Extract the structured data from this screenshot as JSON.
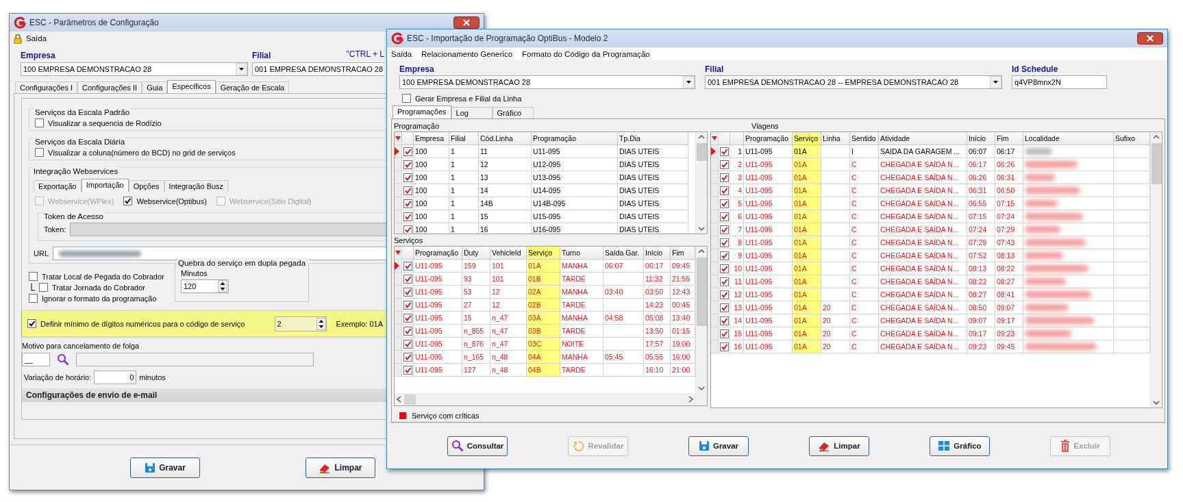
{
  "config_window": {
    "title": "ESC - Parâmetros de Configuração",
    "menu": [
      {
        "label": "Saída"
      }
    ],
    "empresa": {
      "label": "Empresa",
      "value": "100 EMPRESA DEMONSTRACAO 28"
    },
    "filial": {
      "label": "Filial",
      "value": "001 EMPRESA DEMONSTRACAO 28"
    },
    "shortcut_hint": "\"CTRL + L",
    "tabs": [
      {
        "label": "Configurações I",
        "selected": false
      },
      {
        "label": "Configurações II",
        "selected": false
      },
      {
        "label": "Guia",
        "selected": false
      },
      {
        "label": "Específicos",
        "selected": true
      },
      {
        "label": "Geração de Escala",
        "selected": false
      }
    ],
    "groups": [
      {
        "title": "Serviços da Escala Padrão",
        "option": {
          "label": "Visualizar a sequencia de Rodízio",
          "checked": false
        }
      },
      {
        "title": "Serviços da Escala Diária",
        "option": {
          "label": "Visualizar a coluna(número do BCD) no grid de serviços",
          "checked": false
        }
      }
    ],
    "webservices": {
      "title": "Integração Webservices",
      "tabs": [
        {
          "label": "Exportação",
          "selected": false
        },
        {
          "label": "Importação",
          "selected": true
        },
        {
          "label": "Opções",
          "selected": false
        },
        {
          "label": "Integração Busz",
          "selected": false
        }
      ],
      "options": [
        {
          "label": "Webservice(WPlex)",
          "checked": false,
          "disabled": true
        },
        {
          "label": "Webservice(Optibus)",
          "checked": true,
          "disabled": false
        },
        {
          "label": "Webservice(Sitio Digital)",
          "checked": false,
          "disabled": true
        }
      ],
      "token_group": "Token de Acesso",
      "token_label": "Token:",
      "url_label": "URL"
    },
    "collector_options": [
      {
        "label": "Tratar Local de Pegada do Cobrador",
        "checked": false,
        "children": [
          {
            "label": "Tratar  Jornada do Cobrador",
            "checked": false
          }
        ]
      },
      {
        "label": "Ignorar o formato da programação",
        "checked": false
      }
    ],
    "split_group": {
      "title": "Quebra do serviço em dupla pegada",
      "field_label": "Minutos",
      "value": "120"
    },
    "min_digits": {
      "label": "Definir mínimo de dígitos numéricos para o código de serviço",
      "checked": true,
      "value": "2",
      "example": "Exemplo: 01A",
      "highlighted": true
    },
    "cancel_reason": {
      "label": "Motivo para cancelamento de folga",
      "code": "__"
    },
    "time_variation": {
      "label": "Variação de horário:",
      "value": "0",
      "unit": "minutos"
    },
    "email_section": "Configurações de envio de e-mail",
    "buttons": [
      {
        "label": "Gravar",
        "kind": "save",
        "disabled": false
      },
      {
        "label": "Limpar",
        "kind": "clear",
        "disabled": false
      }
    ]
  },
  "import_window": {
    "title": "ESC - Importação de Programação OptiBus - Modelo 2",
    "menu": [
      {
        "label": "Saída"
      },
      {
        "label": "Relacionamento Generico"
      },
      {
        "label": "Formato do Código da Programação"
      }
    ],
    "empresa": {
      "label": "Empresa",
      "value": "100 EMPRESA DEMONSTRACAO 28"
    },
    "filial": {
      "label": "Filial",
      "value": "001 EMPRESA DEMONSTRACAO 28 -- EMPRESA DEMONSTRACAO 28"
    },
    "id_schedule": {
      "label": "Id Schedule",
      "value": "q4VP8mnx2N"
    },
    "generate_option": {
      "label": "Gerar Empresa e Filial da Linha",
      "checked": false
    },
    "tabs": [
      {
        "label": "Programações",
        "selected": true
      },
      {
        "label": "Log",
        "selected": false
      },
      {
        "label": "Gráfico",
        "selected": false
      }
    ],
    "programacao": {
      "title": "Programação",
      "columns": [
        {
          "label": "Empresa",
          "kind": "text"
        },
        {
          "label": "Filial",
          "kind": "text"
        },
        {
          "label": "Cód.Linha",
          "kind": "text"
        },
        {
          "label": "Programação",
          "kind": "text"
        },
        {
          "label": "Tp.Dia",
          "kind": "text"
        }
      ],
      "rows": [
        {
          "current": true,
          "checked": true,
          "critical": false,
          "cells": [
            "100",
            "1",
            "11",
            "U11-095",
            "DIAS UTEIS"
          ]
        },
        {
          "current": false,
          "checked": true,
          "critical": false,
          "cells": [
            "100",
            "1",
            "12",
            "U12-095",
            "DIAS UTEIS"
          ]
        },
        {
          "current": false,
          "checked": true,
          "critical": false,
          "cells": [
            "100",
            "1",
            "13",
            "U13-095",
            "DIAS UTEIS"
          ]
        },
        {
          "current": false,
          "checked": true,
          "critical": false,
          "cells": [
            "100",
            "1",
            "14",
            "U14-095",
            "DIAS UTEIS"
          ]
        },
        {
          "current": false,
          "checked": true,
          "critical": false,
          "cells": [
            "100",
            "1",
            "14B",
            "U14B-095",
            "DIAS UTEIS"
          ]
        },
        {
          "current": false,
          "checked": true,
          "critical": false,
          "cells": [
            "100",
            "1",
            "15",
            "U15-095",
            "DIAS UTEIS"
          ]
        },
        {
          "current": false,
          "checked": true,
          "critical": false,
          "cells": [
            "100",
            "1",
            "16",
            "U16-095",
            "DIAS UTEIS"
          ]
        }
      ]
    },
    "servicos": {
      "title": "Serviços",
      "columns": [
        {
          "label": "Programação",
          "kind": "text"
        },
        {
          "label": "Duty",
          "kind": "text"
        },
        {
          "label": "VehicleId",
          "kind": "text"
        },
        {
          "label": "Serviço",
          "kind": "text",
          "highlighted": true
        },
        {
          "label": "Turno",
          "kind": "text"
        },
        {
          "label": "Saída Gar.",
          "kind": "text"
        },
        {
          "label": "Início",
          "kind": "text"
        },
        {
          "label": "Fim",
          "kind": "text"
        }
      ],
      "rows": [
        {
          "current": true,
          "checked": true,
          "critical": true,
          "cells": [
            "U11-095",
            "159",
            "101",
            "01A",
            "MANHA",
            "06:07",
            "06:17",
            "09:45"
          ]
        },
        {
          "current": false,
          "checked": true,
          "critical": true,
          "cells": [
            "U11-095",
            "93",
            "101",
            "01B",
            "TARDE",
            null,
            "11:32",
            "21:55"
          ]
        },
        {
          "current": false,
          "checked": true,
          "critical": true,
          "cells": [
            "U11-095",
            "53",
            "12",
            "02A",
            "MANHA",
            "03:40",
            "03:50",
            "12:43"
          ]
        },
        {
          "current": false,
          "checked": true,
          "critical": true,
          "cells": [
            "U11-095",
            "27",
            "12",
            "02B",
            "TARDE",
            null,
            "14:23",
            "00:45"
          ]
        },
        {
          "current": false,
          "checked": true,
          "critical": true,
          "cells": [
            "U11-095",
            "15",
            "n_47",
            "03A",
            "MANHA",
            "04:58",
            "05:08",
            "13:40"
          ]
        },
        {
          "current": false,
          "checked": true,
          "critical": true,
          "cells": [
            "U11-095",
            "n_855",
            "n_47",
            "03B",
            "TARDE",
            null,
            "13:50",
            "01:15"
          ]
        },
        {
          "current": false,
          "checked": true,
          "critical": true,
          "cells": [
            "U11-095",
            "n_876",
            "n_47",
            "03C",
            "NOITE",
            null,
            "17:57",
            "19:00"
          ]
        },
        {
          "current": false,
          "checked": true,
          "critical": true,
          "cells": [
            "U11-095",
            "n_165",
            "n_48",
            "04A",
            "MANHA",
            "05:45",
            "05:55",
            "16:00"
          ]
        },
        {
          "current": false,
          "checked": true,
          "critical": true,
          "cells": [
            "U11-095",
            "127",
            "n_48",
            "04B",
            "TARDE",
            null,
            "16:10",
            "21:00"
          ]
        }
      ]
    },
    "viagens": {
      "title": "Viagens",
      "columns": [
        {
          "kind": "row_number"
        },
        {
          "label": "Programação",
          "kind": "text"
        },
        {
          "label": "Serviço",
          "kind": "text",
          "highlighted": true
        },
        {
          "label": "Linha",
          "kind": "text"
        },
        {
          "label": "Sentido",
          "kind": "text"
        },
        {
          "label": "Atividade",
          "kind": "text"
        },
        {
          "label": "Início",
          "kind": "text"
        },
        {
          "label": "Fim",
          "kind": "text"
        },
        {
          "label": "Localidade",
          "kind": "blurred"
        },
        {
          "label": "Sufixo",
          "kind": "text"
        }
      ],
      "rows": [
        {
          "current": true,
          "checked": true,
          "critical": false,
          "cells": [
            "1",
            "U11-095",
            "01A",
            null,
            "I",
            "SAIDA DA GARAGEM ...",
            "06:07",
            "06:17",
            null
          ]
        },
        {
          "current": false,
          "checked": true,
          "critical": true,
          "cells": [
            "2",
            "U11-095",
            "01A",
            null,
            "C",
            "CHEGADA E SAÍDA N...",
            "06:17",
            "06:26",
            null
          ]
        },
        {
          "current": false,
          "checked": true,
          "critical": true,
          "cells": [
            "3",
            "U11-095",
            "01A",
            null,
            "C",
            "CHEGADA E SAÍDA N...",
            "06:26",
            "06:31",
            null
          ]
        },
        {
          "current": false,
          "checked": true,
          "critical": true,
          "cells": [
            "4",
            "U11-095",
            "01A",
            null,
            "C",
            "CHEGADA E SAÍDA N...",
            "06:31",
            "06:50",
            null
          ]
        },
        {
          "current": false,
          "checked": true,
          "critical": true,
          "cells": [
            "5",
            "U11-095",
            "01A",
            null,
            "C",
            "CHEGADA E SAÍDA N...",
            "06:55",
            "07:15",
            null
          ]
        },
        {
          "current": false,
          "checked": true,
          "critical": true,
          "cells": [
            "6",
            "U11-095",
            "01A",
            null,
            "C",
            "CHEGADA E SAÍDA N...",
            "07:15",
            "07:24",
            null
          ]
        },
        {
          "current": false,
          "checked": true,
          "critical": true,
          "cells": [
            "7",
            "U11-095",
            "01A",
            null,
            "C",
            "CHEGADA E SAÍDA N...",
            "07:24",
            "07:29",
            null
          ]
        },
        {
          "current": false,
          "checked": true,
          "critical": true,
          "cells": [
            "8",
            "U11-095",
            "01A",
            null,
            "C",
            "CHEGADA E SAÍDA N...",
            "07:29",
            "07:43",
            null
          ]
        },
        {
          "current": false,
          "checked": true,
          "critical": true,
          "cells": [
            "9",
            "U11-095",
            "01A",
            null,
            "C",
            "CHEGADA E SAÍDA N...",
            "07:52",
            "08:13",
            null
          ]
        },
        {
          "current": false,
          "checked": true,
          "critical": true,
          "cells": [
            "10",
            "U11-095",
            "01A",
            null,
            "C",
            "CHEGADA E SAÍDA N...",
            "08:13",
            "08:22",
            null
          ]
        },
        {
          "current": false,
          "checked": true,
          "critical": true,
          "cells": [
            "11",
            "U11-095",
            "01A",
            null,
            "C",
            "CHEGADA E SAÍDA N...",
            "08:22",
            "08:27",
            null
          ]
        },
        {
          "current": false,
          "checked": true,
          "critical": true,
          "cells": [
            "12",
            "U11-095",
            "01A",
            null,
            "C",
            "CHEGADA E SAÍDA N...",
            "08:27",
            "08:41",
            null
          ]
        },
        {
          "current": false,
          "checked": true,
          "critical": true,
          "cells": [
            "13",
            "U11-095",
            "01A",
            "20",
            "C",
            "CHEGADA E SAÍDA N...",
            "08:50",
            "09:07",
            null
          ]
        },
        {
          "current": false,
          "checked": true,
          "critical": true,
          "cells": [
            "14",
            "U11-095",
            "01A",
            "20",
            "C",
            "CHEGADA E SAÍDA N...",
            "09:07",
            "09:17",
            null
          ]
        },
        {
          "current": false,
          "checked": true,
          "critical": true,
          "cells": [
            "15",
            "U11-095",
            "01A",
            "20",
            "C",
            "CHEGADA E SAÍDA N...",
            "09:17",
            "09:23",
            null
          ]
        },
        {
          "current": false,
          "checked": true,
          "critical": true,
          "cells": [
            "16",
            "U11-095",
            "01A",
            "20",
            "C",
            "CHEGADA E SAÍDA N...",
            "09:23",
            "09:45",
            null
          ]
        }
      ]
    },
    "legend": {
      "label": "Serviço com críticas"
    },
    "buttons": [
      {
        "label": "Consultar",
        "kind": "search",
        "disabled": false
      },
      {
        "label": "Revalidar",
        "kind": "refresh",
        "disabled": true
      },
      {
        "label": "Gravar",
        "kind": "save",
        "disabled": false
      },
      {
        "label": "Limpar",
        "kind": "clear",
        "disabled": false
      },
      {
        "label": "Gráfico",
        "kind": "chart",
        "disabled": false
      },
      {
        "label": "Excluir",
        "kind": "delete",
        "disabled": true
      }
    ]
  }
}
